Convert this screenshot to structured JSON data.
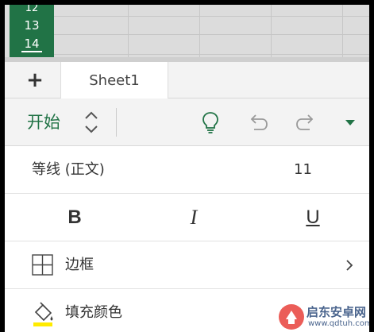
{
  "grid": {
    "row_numbers": [
      "12",
      "13",
      "14"
    ]
  },
  "sheet_tabs": {
    "add_label": "+",
    "active_tab": "Sheet1"
  },
  "ribbon": {
    "title": "开始",
    "icons": [
      "updown-switch-icon",
      "lightbulb-icon",
      "undo-icon",
      "redo-icon",
      "dropdown-arrow-icon"
    ],
    "accent_color": "#217346"
  },
  "font_row": {
    "font_name": "等线 (正文)",
    "font_size": "11"
  },
  "style_row": {
    "bold": "B",
    "italic": "I",
    "underline": "U"
  },
  "border_row": {
    "label": "边框"
  },
  "fill_row": {
    "label": "填充颜色",
    "fill_color": "#ffeb00"
  },
  "watermark": {
    "title": "启东安卓网",
    "url": "www.qdtuh.com"
  }
}
